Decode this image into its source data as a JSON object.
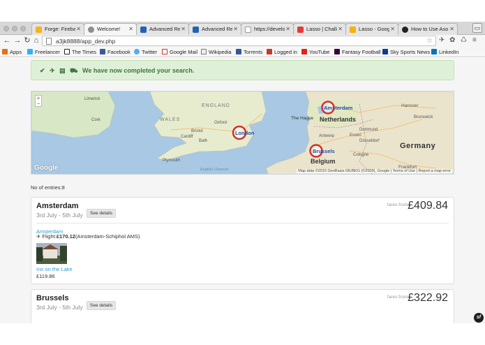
{
  "browser": {
    "tabs": [
      {
        "title": "Forge: Firebase",
        "icon": "forge-icon",
        "color": "#f3b41c",
        "active": false
      },
      {
        "title": "Welcome!",
        "icon": "welcome-icon",
        "color": "#555555",
        "active": true
      },
      {
        "title": "Advanced Rest",
        "icon": "rest-client-icon",
        "color": "#1f63b4",
        "active": false
      },
      {
        "title": "Advanced Rest",
        "icon": "rest-client-icon",
        "color": "#1f63b4",
        "active": false
      },
      {
        "title": "https://develop",
        "icon": "page-icon",
        "color": "#9aa0a6",
        "active": false
      },
      {
        "title": "Lasso | Challeng",
        "icon": "lasso-icon",
        "color": "#e53935",
        "active": false
      },
      {
        "title": "Lasso - Google",
        "icon": "google-slides-icon",
        "color": "#f4b400",
        "active": false
      },
      {
        "title": "How to Use Aso",
        "icon": "wordpress-icon",
        "color": "#222222",
        "active": false
      }
    ],
    "url": "a3jk8888/app_dev.php",
    "bookmarks": [
      {
        "label": "Apps",
        "icon": "apps-grid-icon",
        "color": "#e8710a"
      },
      {
        "label": "Freelancer",
        "icon": "freelancer-icon",
        "color": "#29b2fe"
      },
      {
        "label": "The Times",
        "icon": "the-times-icon",
        "color": "#222222"
      },
      {
        "label": "Facebook",
        "icon": "facebook-icon",
        "color": "#3b5998"
      },
      {
        "label": "Twitter",
        "icon": "twitter-icon",
        "color": "#55acee"
      },
      {
        "label": "Google Mail",
        "icon": "gmail-icon",
        "color": "#d93025"
      },
      {
        "label": "Wikipedia",
        "icon": "wikipedia-icon",
        "color": "#333333"
      },
      {
        "label": "Torrents",
        "icon": "torrents-icon",
        "color": "#2e5a9b"
      },
      {
        "label": "Logged in",
        "icon": "logged-in-icon",
        "color": "#c0392b"
      },
      {
        "label": "YouTube",
        "icon": "youtube-icon",
        "color": "#e62117"
      },
      {
        "label": "Fantasy Football",
        "icon": "fantasy-football-icon",
        "color": "#38003c"
      },
      {
        "label": "Sky Sports News",
        "icon": "sky-sports-icon",
        "color": "#0b3d91"
      },
      {
        "label": "LinkedIn",
        "icon": "linkedin-icon",
        "color": "#0077b5"
      }
    ]
  },
  "alert": {
    "message": "We have now completed your search.",
    "icons": [
      "check-icon",
      "plane-icon",
      "hotel-icon",
      "car-icon"
    ],
    "color": "#3c763d"
  },
  "map": {
    "places": {
      "country_england": "ENGLAND",
      "country_wales": "WALES",
      "country_netherlands": "Netherlands",
      "country_germany": "Germany",
      "country_belgium": "Belgium",
      "city_limerick": "Limerick",
      "city_cork": "Cork",
      "city_oxford": "Oxford",
      "city_bristol": "Bristol",
      "city_cardiff": "Cardiff",
      "city_bath": "Bath",
      "city_plymouth": "Plymouth",
      "city_hague": "The Hague",
      "city_antwerp": "Antwerp",
      "city_essen": "Essen",
      "city_dortmund": "Dortmund",
      "city_dusseldorf": "Düsseldorf",
      "city_cologne": "Cologne",
      "city_hanover": "Hanover",
      "city_brunswick": "Brunswick",
      "city_frankfurt": "Frankfurt",
      "sea": "English Channel"
    },
    "markers": [
      "London",
      "Amsterdam",
      "Brussels"
    ],
    "zoom_in": "+",
    "zoom_out": "−",
    "logo": "Google",
    "attribution": "Map data ©2015 GeoBasis-DE/BKG (©2009), Google | Terms of Use | Report a map error"
  },
  "results": {
    "entries_text": "No of entries:8",
    "cards": [
      {
        "city": "Amsterdam",
        "dates": "3rd July - 5th July",
        "details_label": "See details",
        "fares_from": "fares from",
        "price": "£409.84",
        "dest_link": "Amsterdam",
        "flight_prefix": "Flight:",
        "flight_price": "£170.12",
        "flight_route": "(Amsterdam-Schiphol AMS)",
        "hotel_name": "Inn on the Lake",
        "hotel_price": "£119.86"
      },
      {
        "city": "Brussels",
        "dates": "3rd July - 5th July",
        "details_label": "See details",
        "fares_from": "fares from",
        "price": "£322.92"
      }
    ]
  },
  "corner_badge": "sf"
}
